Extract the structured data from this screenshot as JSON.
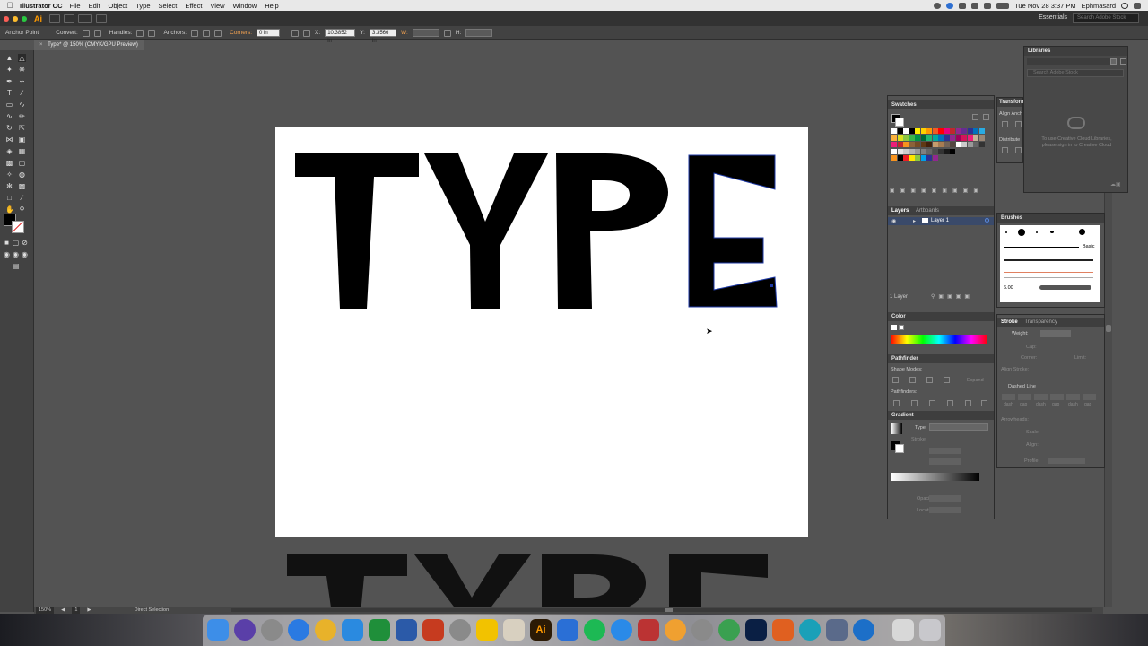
{
  "menubar": {
    "app": "Illustrator CC",
    "items": [
      "File",
      "Edit",
      "Object",
      "Type",
      "Select",
      "Effect",
      "View",
      "Window",
      "Help"
    ],
    "datetime": "Tue Nov 28  3:37 PM",
    "user": "Ephmasard"
  },
  "appbar": {
    "logo": "Ai",
    "workspace": "Essentials",
    "search_placeholder": "Search Adobe Stock"
  },
  "controlbar": {
    "selection": "Anchor Point",
    "convert": "Convert:",
    "handles": "Handles:",
    "anchors": "Anchors:",
    "corners": "Corners:",
    "corners_value": "0 in",
    "x_label": "X:",
    "x_value": "10.3852 in",
    "y_label": "Y:",
    "y_value": "3.3566 in",
    "w_label": "W:",
    "h_label": "H:"
  },
  "document": {
    "tab_title": "Type* @ 150% (CMYK/GPU Preview)",
    "close": "×",
    "artwork_letters": [
      "T",
      "Y",
      "P",
      "E"
    ],
    "offboard_text": "TYPE"
  },
  "statusbar": {
    "zoom": "150%",
    "page": "1",
    "tool": "Direct Selection"
  },
  "panels": {
    "swatches": {
      "title": "Swatches"
    },
    "layers": {
      "tabs": [
        "Layers",
        "Artboards"
      ],
      "layer_name": "Layer 1",
      "count": "1 Layer"
    },
    "color": {
      "title": "Color"
    },
    "pathfinder": {
      "title": "Pathfinder",
      "shape_modes": "Shape Modes:",
      "expand": "Expand",
      "pathfinders": "Pathfinders:"
    },
    "gradient": {
      "title": "Gradient",
      "type_label": "Type:",
      "stroke_label": "Stroke:",
      "opacity_label": "Opacity:",
      "location_label": "Location:"
    },
    "libraries": {
      "title": "Libraries",
      "search_placeholder": "Search Adobe Stock",
      "message_line1": "To use Creative Cloud Libraries,",
      "message_line2": "please sign in to Creative Cloud"
    },
    "transform": {
      "title": "Transform",
      "align": "Align Anch",
      "distribute": "Distribute"
    },
    "brushes": {
      "title": "Brushes",
      "basic": "Basic",
      "size": "6.00"
    },
    "stroke": {
      "tabs": [
        "Stroke",
        "Transparency"
      ],
      "weight": "Weight:",
      "cap": "Cap:",
      "corner": "Corner:",
      "limit": "Limit:",
      "align": "Align Stroke:",
      "dashed": "Dashed Line",
      "dash_labels": [
        "dash",
        "gap",
        "dash",
        "gap",
        "dash",
        "gap"
      ],
      "arrowheads": "Arrowheads:",
      "scale": "Scale:",
      "align2": "Align:",
      "profile": "Profile:"
    }
  },
  "colors": {
    "accent_orange": "#ff9a00",
    "selection_blue": "#1f3aa6",
    "panel_bg": "#535353"
  }
}
